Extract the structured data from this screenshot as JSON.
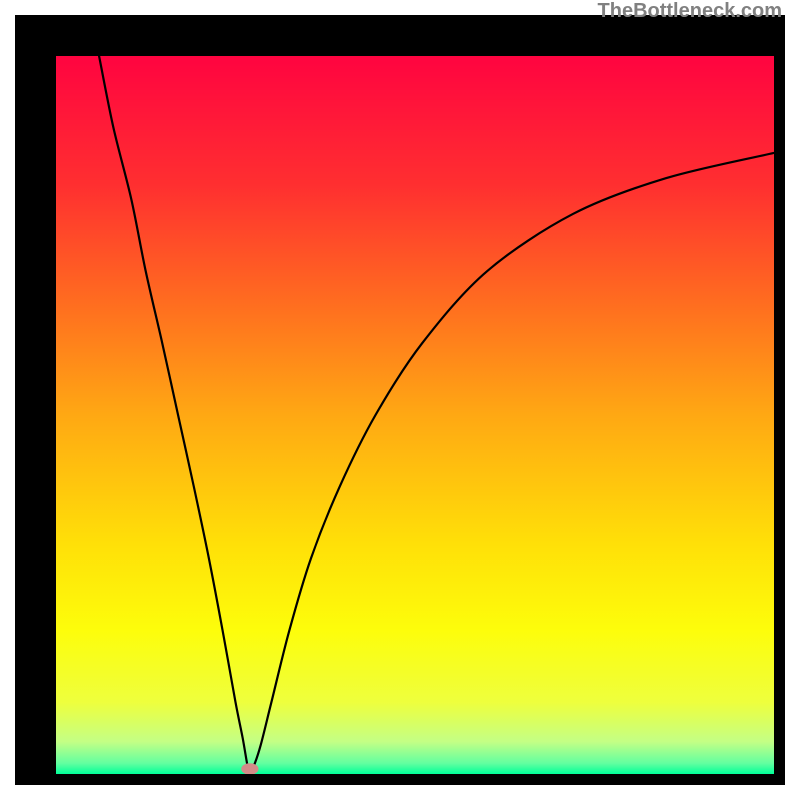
{
  "attribution": "TheBottleneck.com",
  "chart_data": {
    "type": "line",
    "title": "",
    "xlabel": "",
    "ylabel": "",
    "x_range": [
      0,
      100
    ],
    "y_range": [
      0,
      100
    ],
    "background_gradient": {
      "stops": [
        {
          "pos": 0.0,
          "color": "#ff0440"
        },
        {
          "pos": 0.18,
          "color": "#ff2f30"
        },
        {
          "pos": 0.35,
          "color": "#ff6f1f"
        },
        {
          "pos": 0.5,
          "color": "#ffa813"
        },
        {
          "pos": 0.68,
          "color": "#ffe008"
        },
        {
          "pos": 0.8,
          "color": "#fdfd0b"
        },
        {
          "pos": 0.9,
          "color": "#eeff3d"
        },
        {
          "pos": 0.955,
          "color": "#c4ff85"
        },
        {
          "pos": 0.985,
          "color": "#63ffa0"
        },
        {
          "pos": 1.0,
          "color": "#00ff99"
        }
      ]
    },
    "marker": {
      "x": 27.0,
      "y": 0.7,
      "color": "#d38b88",
      "rx": 1.2,
      "ry": 0.8
    },
    "series": [
      {
        "name": "bottleneck-curve",
        "color": "#000000",
        "points": [
          {
            "x": 6.0,
            "y": 100.0
          },
          {
            "x": 8.0,
            "y": 90.0
          },
          {
            "x": 10.5,
            "y": 80.0
          },
          {
            "x": 12.5,
            "y": 70.0
          },
          {
            "x": 14.8,
            "y": 60.0
          },
          {
            "x": 17.0,
            "y": 50.0
          },
          {
            "x": 19.2,
            "y": 40.0
          },
          {
            "x": 21.3,
            "y": 30.0
          },
          {
            "x": 23.2,
            "y": 20.0
          },
          {
            "x": 25.0,
            "y": 10.0
          },
          {
            "x": 26.0,
            "y": 5.0
          },
          {
            "x": 26.7,
            "y": 1.0
          },
          {
            "x": 27.0,
            "y": 0.4
          },
          {
            "x": 27.5,
            "y": 1.0
          },
          {
            "x": 28.5,
            "y": 4.0
          },
          {
            "x": 30.0,
            "y": 10.0
          },
          {
            "x": 32.5,
            "y": 20.0
          },
          {
            "x": 35.5,
            "y": 30.0
          },
          {
            "x": 39.5,
            "y": 40.0
          },
          {
            "x": 44.5,
            "y": 50.0
          },
          {
            "x": 51.0,
            "y": 60.0
          },
          {
            "x": 60.0,
            "y": 70.0
          },
          {
            "x": 72.0,
            "y": 78.0
          },
          {
            "x": 85.0,
            "y": 83.0
          },
          {
            "x": 100.0,
            "y": 86.5
          }
        ]
      }
    ]
  }
}
